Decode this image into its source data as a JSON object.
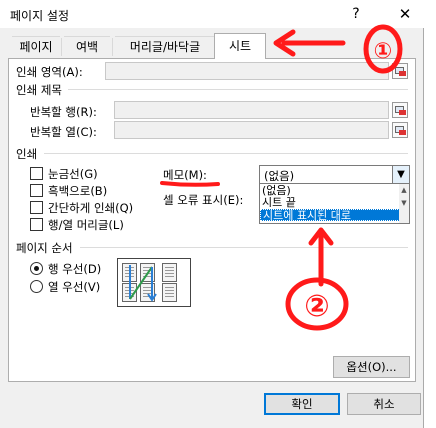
{
  "window": {
    "title": "페이지 설정",
    "help": "?",
    "close": "✕"
  },
  "tabs": [
    "페이지",
    "여백",
    "머리글/바닥글",
    "시트"
  ],
  "active_tab": "시트",
  "print_area": {
    "label": "인쇄 영역(A):"
  },
  "print_titles": {
    "section": "인쇄 제목",
    "rows_label": "반복할 행(R):",
    "cols_label": "반복할 열(C):"
  },
  "print": {
    "section": "인쇄",
    "checkboxes": [
      "눈금선(G)",
      "흑백으로(B)",
      "간단하게 인쇄(Q)",
      "행/열 머리글(L)"
    ],
    "comments_label": "메모(M):",
    "comments_value": "(없음)",
    "comments_options": [
      "(없음)",
      "시트 끝",
      "시트에 표시된 대로"
    ],
    "comments_selected": "시트에 표시된 대로",
    "errors_label": "셀 오류 표시(E):"
  },
  "page_order": {
    "section": "페이지 순서",
    "options": [
      "행 우선(D)",
      "열 우선(V)"
    ],
    "selected": "행 우선(D)"
  },
  "buttons": {
    "options": "옵션(O)...",
    "ok": "확인",
    "cancel": "취소"
  },
  "annotations": [
    "①",
    "②"
  ],
  "colors": {
    "annotation_red": "#ff1a1a",
    "selection_blue": "#0078d7"
  }
}
